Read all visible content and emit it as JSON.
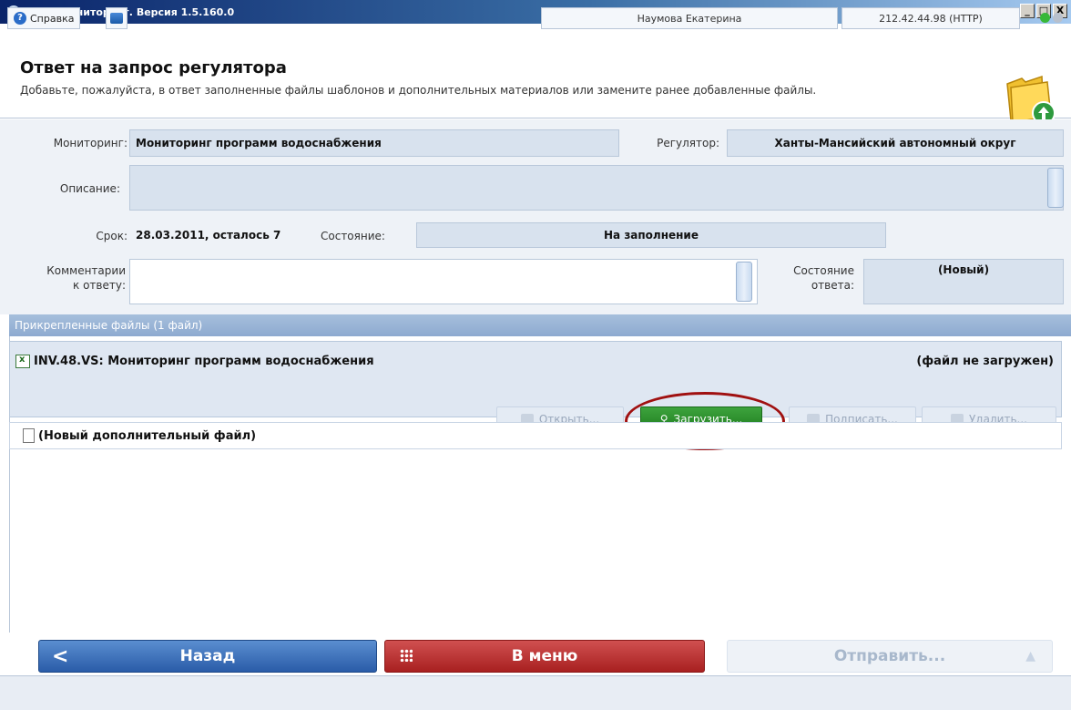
{
  "window": {
    "title": "ЕИАС Мониторинг. Версия 1.5.160.0",
    "buttons": [
      "_",
      "□",
      "X"
    ]
  },
  "header": {
    "title": "Ответ на запрос регулятора",
    "subtitle": "Добавьте, пожалуйста, в ответ заполненные файлы шаблонов и дополнительных материалов или замените ранее добавленные файлы.",
    "icon": "folder-upload-icon"
  },
  "form": {
    "monitoring_label": "Мониторинг:",
    "monitoring_value": "Мониторинг программ водоснабжения",
    "regulator_label": "Регулятор:",
    "regulator_value": "Ханты-Мансийский автономный округ",
    "description_label": "Описание:",
    "description_value": "",
    "deadline_label": "Срок:",
    "deadline_value": "28.03.2011, осталось 7",
    "state_label": "Состояние:",
    "state_value": "На заполнение",
    "comment_label_1": "Комментарии",
    "comment_label_2": "к ответу:",
    "comment_value": "",
    "answer_state_label_1": "Состояние",
    "answer_state_label_2": "ответа:",
    "answer_state_value": "(Новый)"
  },
  "files": {
    "header": "Прикрепленные файлы (1 файл)",
    "items": [
      {
        "name": "INV.48.VS: Мониторинг программ водоснабжения",
        "status": "(файл не загружен)",
        "icon": "excel-file-icon"
      }
    ],
    "buttons": {
      "open": "Открыть...",
      "upload": "Загрузить...",
      "sign": "Подписать...",
      "delete": "Удалить..."
    },
    "new_file_label": "(Новый дополнительный файл)"
  },
  "nav": {
    "back": "Назад",
    "menu": "В меню",
    "send": "Отправить..."
  },
  "statusbar": {
    "help": "Справка",
    "user": "Наумова Екатерина",
    "server": "212.42.44.98 (HTTP)"
  },
  "colors": {
    "accent_blue": "#2a5ca8",
    "menu_red": "#a82020",
    "upload_green": "#1f7d1f",
    "highlight_oval": "#a01010"
  }
}
